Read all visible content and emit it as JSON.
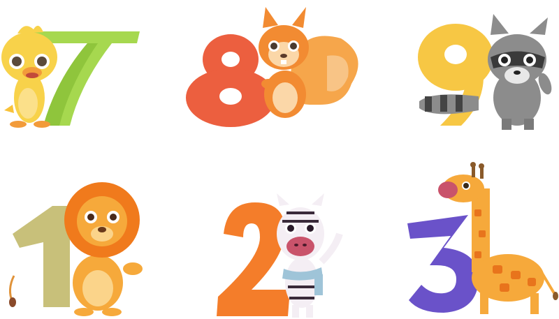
{
  "cards": [
    {
      "id": "duck",
      "number": "7",
      "animal": "duck-icon",
      "number_color": "#a6d84f"
    },
    {
      "id": "squirrel",
      "number": "8",
      "animal": "squirrel-icon",
      "number_color": "#ec5f3f"
    },
    {
      "id": "raccoon",
      "number": "9",
      "animal": "raccoon-icon",
      "number_color": "#f7c744"
    },
    {
      "id": "lion",
      "number": "1",
      "animal": "lion-icon",
      "number_color": "#c8c07a"
    },
    {
      "id": "zebra",
      "number": "2",
      "animal": "zebra-icon",
      "number_color": "#f47d2a"
    },
    {
      "id": "giraffe",
      "number": "3",
      "animal": "giraffe-icon",
      "number_color": "#6a52c9"
    }
  ]
}
